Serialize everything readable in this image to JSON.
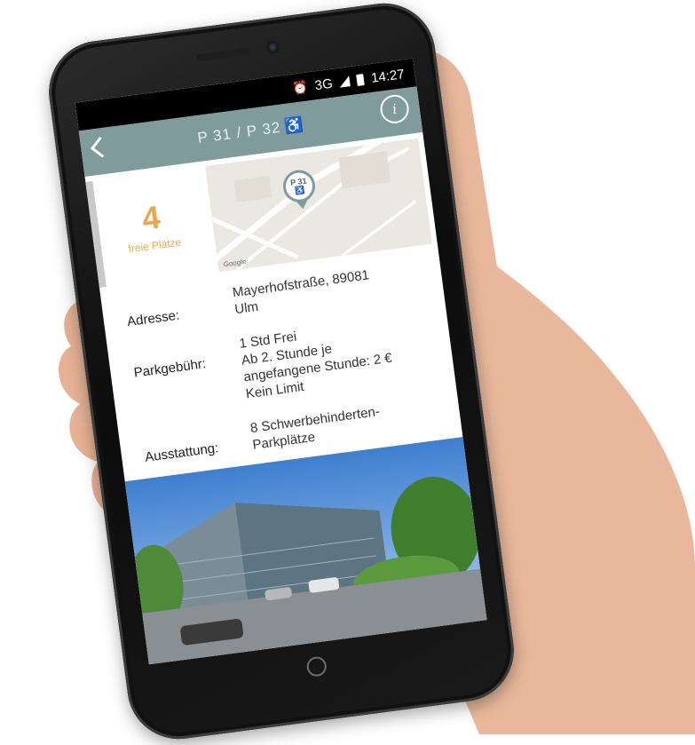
{
  "status_bar": {
    "network": "3G",
    "time": "14:27",
    "icons": [
      "alarm-icon",
      "signal-icon",
      "battery-icon"
    ]
  },
  "app_bar": {
    "title": "P 31 / P 32",
    "back_icon": "chevron-left-icon",
    "title_icon": "wheelchair-icon",
    "info_label": "i",
    "color": "#7f9b9b"
  },
  "availability": {
    "count": "4",
    "label": "freie Plätze",
    "color": "#e8a94e"
  },
  "map": {
    "pin_label": "P 31 ♿",
    "provider": "Google"
  },
  "details": [
    {
      "label": "Adresse:",
      "lines": [
        "Mayerhofstraße, 89081",
        "Ulm"
      ]
    },
    {
      "label": "Parkgebühr:",
      "lines": [
        "1 Std Frei",
        "Ab 2. Stunde je",
        "angefangene Stunde: 2 €",
        "Kein Limit"
      ]
    },
    {
      "label": "Ausstattung:",
      "lines": [
        "8 Schwerbehinderten-",
        "Parkplätze"
      ]
    }
  ]
}
